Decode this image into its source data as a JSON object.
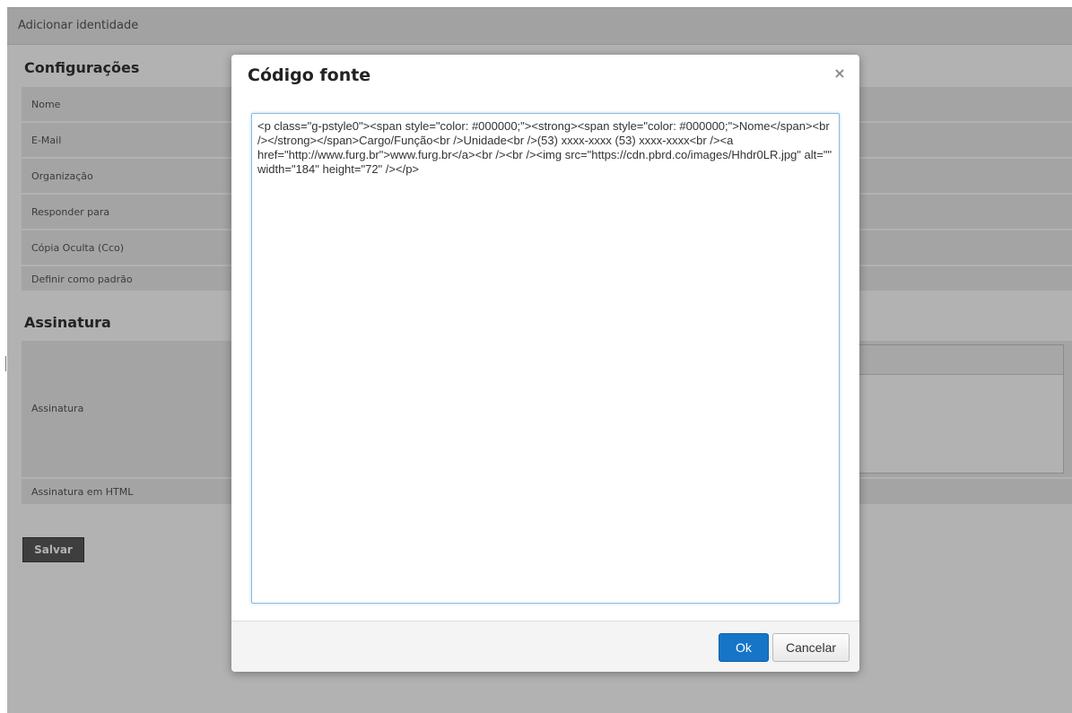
{
  "page": {
    "header_title": "Adicionar identidade",
    "settings_section_title": "Configurações",
    "fields": [
      {
        "label": "Nome"
      },
      {
        "label": "E-Mail"
      },
      {
        "label": "Organização"
      },
      {
        "label": "Responder para"
      },
      {
        "label": "Cópia Oculta (Cco)"
      },
      {
        "label": "Definir como padrão"
      }
    ],
    "signature_section_title": "Assinatura",
    "signature_label": "Assinatura",
    "html_signature_label": "Assinatura em HTML",
    "save_label": "Salvar"
  },
  "dialog": {
    "title": "Código fonte",
    "close_glyph": "×",
    "source_code": "<p class=\"g-pstyle0\"><span style=\"color: #000000;\"><strong><span style=\"color: #000000;\">Nome</span><br /></strong></span>Cargo/Função<br />Unidade<br />(53) xxxx-xxxx (53) xxxx-xxxx<br /><a href=\"http://www.furg.br\">www.furg.br</a><br /><br /><img src=\"https://cdn.pbrd.co/images/Hhdr0LR.jpg\" alt=\"\" width=\"184\" height=\"72\" /></p>",
    "ok_label": "Ok",
    "cancel_label": "Cancelar"
  },
  "colors": {
    "overlay": "#000000",
    "ok_button": "#1775c7",
    "save_button": "#5a5a5a"
  }
}
